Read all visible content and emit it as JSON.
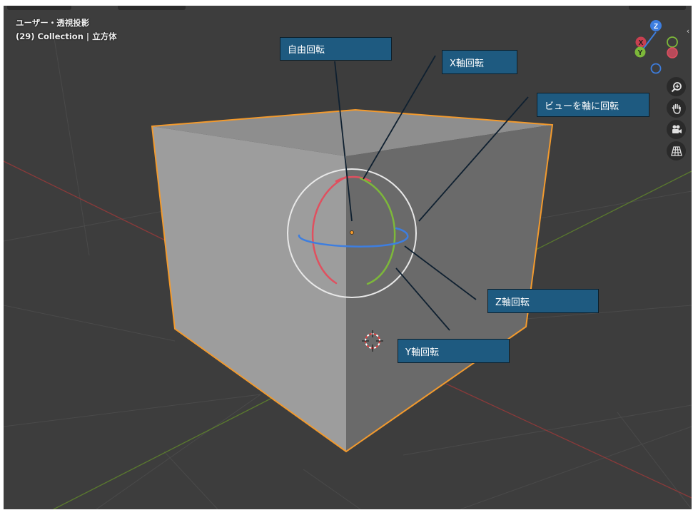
{
  "viewport": {
    "view_mode": "ユーザー・透視投影",
    "collection_line": "(29) Collection | 立方体"
  },
  "gizmo": {
    "z_label": "Z",
    "x_label": "X",
    "y_label": "Y"
  },
  "nav_tools": [
    {
      "name": "zoom",
      "glyph": "🔍"
    },
    {
      "name": "pan",
      "glyph": "✋"
    },
    {
      "name": "camera",
      "glyph": "🎥"
    },
    {
      "name": "grid",
      "glyph": "▦"
    }
  ],
  "callouts": {
    "free_rotate": "自由回転",
    "x_axis_rotate": "X軸回転",
    "view_axis_rotate": "ビューを軸に回転",
    "z_axis_rotate": "Z軸回転",
    "y_axis_rotate": "Y軸回転"
  },
  "colors": {
    "viewport_bg": "#3d3d3d",
    "selection_outline": "#f29a2e",
    "x_axis": "#e0505f",
    "y_axis": "#7db83a",
    "z_axis": "#3d7ee0",
    "callout_bg": "#1e5a80"
  }
}
